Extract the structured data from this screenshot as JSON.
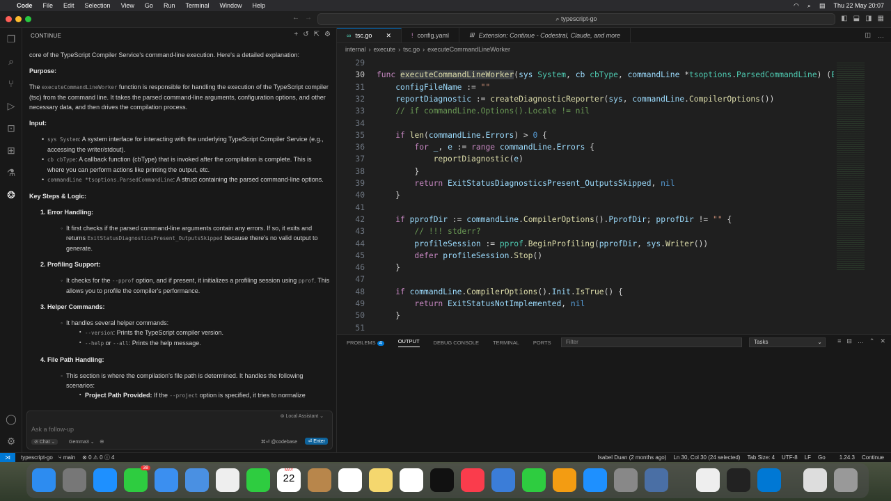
{
  "menubar": {
    "app": "Code",
    "items": [
      "File",
      "Edit",
      "Selection",
      "View",
      "Go",
      "Run",
      "Terminal",
      "Window",
      "Help"
    ],
    "clock": "Thu 22 May  20:07"
  },
  "command_center": "typescript-go",
  "sidebar": {
    "title": "CONTINUE"
  },
  "chat": {
    "intro": "core of the TypeScript Compiler Service's command-line execution. Here's a detailed explanation:",
    "purpose_h": "Purpose:",
    "purpose_1": "The ",
    "purpose_code": "executeCommandLineWorker",
    "purpose_2": " function is responsible for handling the execution of the TypeScript compiler (tsc) from the command line. It takes the parsed command-line arguments, configuration options, and other necessary data, and then drives the compilation process.",
    "input_h": "Input:",
    "inputs": [
      {
        "code": "sys System",
        "text": ": A system interface for interacting with the underlying TypeScript Compiler Service (e.g., accessing the writer/stdout)."
      },
      {
        "code": "cb cbType",
        "text": ": A callback function (cbType) that is invoked after the compilation is complete. This is where you can perform actions like printing the output, etc."
      },
      {
        "code": "commandLine *tsoptions.ParsedCommandLine",
        "text": ": A struct containing the parsed command-line options."
      }
    ],
    "steps_h": "Key Steps & Logic:",
    "step1_h": "1. Error Handling:",
    "step1_a": "It first checks if the parsed command-line arguments contain any errors. If so, it exits and returns ",
    "step1_code": "ExitStatusDiagnosticsPresent_OutputsSkipped",
    "step1_b": " because there's no valid output to generate.",
    "step2_h": "2. Profiling Support:",
    "step2_a": "It checks for the ",
    "step2_code": "--pprof",
    "step2_b": " option, and if present, it initializes a profiling session using ",
    "step2_code2": "pprof",
    "step2_c": ". This allows you to profile the compiler's performance.",
    "step3_h": "3. Helper Commands:",
    "step3_a": "It handles several helper commands:",
    "step3_v_code": "--version",
    "step3_v": ": Prints the TypeScript compiler version.",
    "step3_h_code": "--help",
    "step3_or": " or ",
    "step3_all_code": "--all",
    "step3_hh": ": Prints the help message.",
    "step4_h": "4. File Path Handling:",
    "step4_a": "This section is where the compilation's file path is determined. It handles the following scenarios:",
    "step4_b": "Project Path Provided:",
    "step4_c": " If the ",
    "step4_code": "--project",
    "step4_d": " option is specified, it tries to normalize"
  },
  "chat_input": {
    "placeholder": "Ask a follow-up",
    "assistant": "Local Assistant",
    "mode": "Chat",
    "model": "Gemma3",
    "codebase": "⌘⏎ @codebase",
    "enter": "⏎ Enter"
  },
  "editor": {
    "tabs": [
      {
        "label": "tsc.go",
        "active": true
      },
      {
        "label": "config.yaml",
        "active": false
      },
      {
        "label": "Extension: Continue - Codestral, Claude, and more",
        "active": false
      }
    ],
    "breadcrumb": [
      "internal",
      "execute",
      "tsc.go",
      "executeCommandLineWorker"
    ]
  },
  "code_lines": [
    {
      "n": "29",
      "html": ""
    },
    {
      "n": "30",
      "html": "<span class='k'>func</span> <span class='f hl'>executeCommandLineWorker</span>(<span class='v'>sys</span> <span class='t'>System</span>, <span class='v'>cb</span> <span class='t'>cbType</span>, <span class='v'>commandLine</span> *<span class='t'>tsoptions</span>.<span class='t'>ParsedCommandLine</span>) (<span class='t'>E</span>"
    },
    {
      "n": "31",
      "html": "    <span class='v'>configFileName</span> := <span class='s'>\"\"</span>"
    },
    {
      "n": "32",
      "html": "    <span class='v'>reportDiagnostic</span> := <span class='f'>createDiagnosticReporter</span>(<span class='v'>sys</span>, <span class='v'>commandLine</span>.<span class='f'>CompilerOptions</span>())"
    },
    {
      "n": "33",
      "html": "    <span class='c'>// if commandLine.Options().Locale != nil</span>"
    },
    {
      "n": "34",
      "html": ""
    },
    {
      "n": "35",
      "html": "    <span class='k'>if</span> <span class='f'>len</span>(<span class='v'>commandLine</span>.<span class='v'>Errors</span>) > <span class='n'>0</span> {"
    },
    {
      "n": "36",
      "html": "        <span class='k'>for</span> <span class='v'>_</span>, <span class='v'>e</span> := <span class='k'>range</span> <span class='v'>commandLine</span>.<span class='v'>Errors</span> {"
    },
    {
      "n": "37",
      "html": "            <span class='f'>reportDiagnostic</span>(<span class='v'>e</span>)"
    },
    {
      "n": "38",
      "html": "        }"
    },
    {
      "n": "39",
      "html": "        <span class='k'>return</span> <span class='v'>ExitStatusDiagnosticsPresent_OutputsSkipped</span>, <span class='n'>nil</span>"
    },
    {
      "n": "40",
      "html": "    }"
    },
    {
      "n": "41",
      "html": ""
    },
    {
      "n": "42",
      "html": "    <span class='k'>if</span> <span class='v'>pprofDir</span> := <span class='v'>commandLine</span>.<span class='f'>CompilerOptions</span>().<span class='v'>PprofDir</span>; <span class='v'>pprofDir</span> != <span class='s'>\"\"</span> {"
    },
    {
      "n": "43",
      "html": "        <span class='c'>// !!! stderr?</span>"
    },
    {
      "n": "44",
      "html": "        <span class='v'>profileSession</span> := <span class='t'>pprof</span>.<span class='f'>BeginProfiling</span>(<span class='v'>pprofDir</span>, <span class='v'>sys</span>.<span class='f'>Writer</span>())"
    },
    {
      "n": "45",
      "html": "        <span class='k'>defer</span> <span class='v'>profileSession</span>.<span class='f'>Stop</span>()"
    },
    {
      "n": "46",
      "html": "    }"
    },
    {
      "n": "47",
      "html": ""
    },
    {
      "n": "48",
      "html": "    <span class='k'>if</span> <span class='v'>commandLine</span>.<span class='f'>CompilerOptions</span>().<span class='v'>Init</span>.<span class='f'>IsTrue</span>() {"
    },
    {
      "n": "49",
      "html": "        <span class='k'>return</span> <span class='v'>ExitStatusNotImplemented</span>, <span class='n'>nil</span>"
    },
    {
      "n": "50",
      "html": "    }"
    },
    {
      "n": "51",
      "html": ""
    }
  ],
  "panel": {
    "tabs": [
      "PROBLEMS",
      "OUTPUT",
      "DEBUG CONSOLE",
      "TERMINAL",
      "PORTS"
    ],
    "problems_count": "4",
    "filter_placeholder": "Filter",
    "tasks": "Tasks"
  },
  "status": {
    "repo": "typescript-go",
    "branch": "main",
    "errors": "⊗ 0 ⚠ 0 ⓘ 4",
    "blame": "Isabel Duan (2 months ago)",
    "position": "Ln 30, Col 30 (24 selected)",
    "tab_size": "Tab Size: 4",
    "encoding": "UTF-8",
    "eol": "LF",
    "language": "Go",
    "version": "1.24.3",
    "continue": "Continue"
  },
  "dock": {
    "messages_badge": "38",
    "calendar_month": "MAY",
    "calendar_day": "22"
  }
}
